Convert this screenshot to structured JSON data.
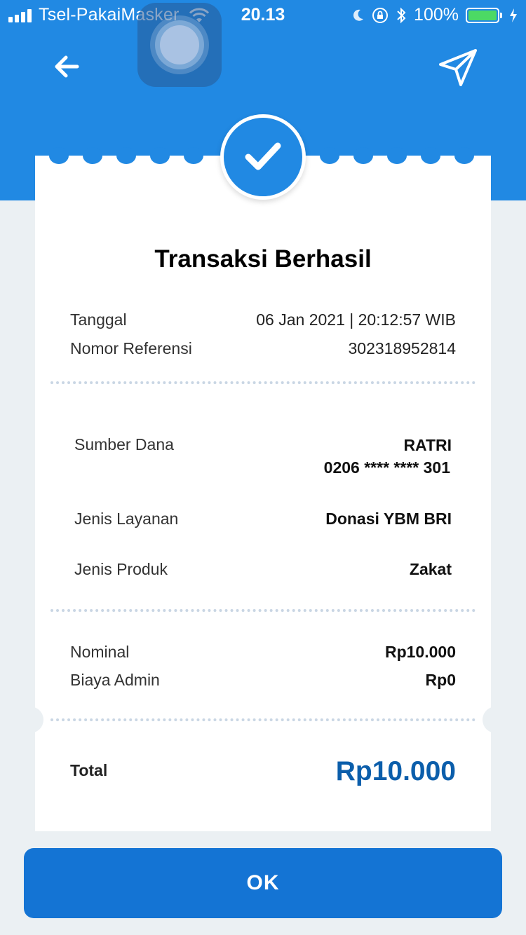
{
  "status_bar": {
    "carrier": "Tsel-PakaiMasker",
    "time": "20.13",
    "battery": "100%"
  },
  "colors": {
    "primary": "#2189e3",
    "button": "#1474d4",
    "total": "#0b5eab",
    "background": "#ebf0f3"
  },
  "icons": {
    "back": "arrow-left-icon",
    "share": "send-icon",
    "success": "check-icon"
  },
  "receipt": {
    "title": "Transaksi Berhasil",
    "tanggal_label": "Tanggal",
    "tanggal_value": "06 Jan 2021 | 20:12:57 WIB",
    "ref_label": "Nomor Referensi",
    "ref_value": "302318952814",
    "sumber_label": "Sumber Dana",
    "sumber_name": "RATRI",
    "sumber_account": "0206 **** **** 301",
    "layanan_label": "Jenis Layanan",
    "layanan_value": "Donasi YBM BRI",
    "produk_label": "Jenis Produk",
    "produk_value": "Zakat",
    "nominal_label": "Nominal",
    "nominal_value": "Rp10.000",
    "admin_label": "Biaya Admin",
    "admin_value": "Rp0",
    "total_label": "Total",
    "total_value": "Rp10.000"
  },
  "ok_button": "OK"
}
